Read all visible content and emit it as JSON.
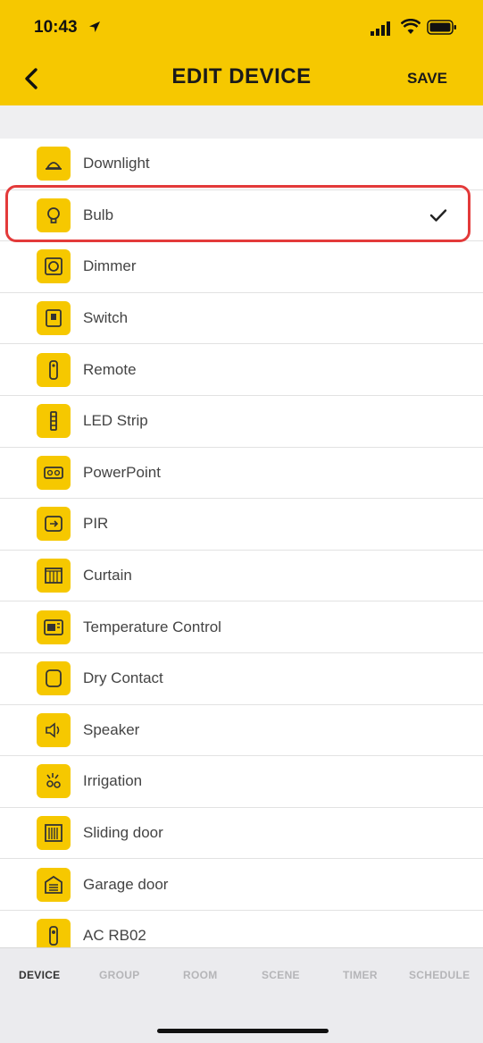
{
  "status_bar": {
    "time": "10:43"
  },
  "header": {
    "title": "EDIT DEVICE",
    "save_label": "SAVE"
  },
  "devices": [
    {
      "label": "Downlight",
      "icon": "downlight-icon",
      "selected": false
    },
    {
      "label": "Bulb",
      "icon": "bulb-icon",
      "selected": true
    },
    {
      "label": "Dimmer",
      "icon": "dimmer-icon",
      "selected": false
    },
    {
      "label": "Switch",
      "icon": "switch-icon",
      "selected": false
    },
    {
      "label": "Remote",
      "icon": "remote-icon",
      "selected": false
    },
    {
      "label": "LED Strip",
      "icon": "led-strip-icon",
      "selected": false
    },
    {
      "label": "PowerPoint",
      "icon": "powerpoint-icon",
      "selected": false
    },
    {
      "label": "PIR",
      "icon": "pir-icon",
      "selected": false
    },
    {
      "label": "Curtain",
      "icon": "curtain-icon",
      "selected": false
    },
    {
      "label": "Temperature Control",
      "icon": "temperature-control-icon",
      "selected": false
    },
    {
      "label": "Dry Contact",
      "icon": "dry-contact-icon",
      "selected": false
    },
    {
      "label": "Speaker",
      "icon": "speaker-icon",
      "selected": false
    },
    {
      "label": "Irrigation",
      "icon": "irrigation-icon",
      "selected": false
    },
    {
      "label": "Sliding door",
      "icon": "sliding-door-icon",
      "selected": false
    },
    {
      "label": "Garage door",
      "icon": "garage-door-icon",
      "selected": false
    },
    {
      "label": "AC RB02",
      "icon": "ac-rb02-icon",
      "selected": false
    }
  ],
  "tabs": [
    {
      "label": "DEVICE",
      "active": true
    },
    {
      "label": "GROUP",
      "active": false
    },
    {
      "label": "ROOM",
      "active": false
    },
    {
      "label": "SCENE",
      "active": false
    },
    {
      "label": "TIMER",
      "active": false
    },
    {
      "label": "SCHEDULE",
      "active": false
    }
  ],
  "colors": {
    "accent": "#F6C800",
    "selection_outline": "#E33A3A",
    "tab_active": "#333333",
    "tab_inactive": "#B5B5B8"
  }
}
